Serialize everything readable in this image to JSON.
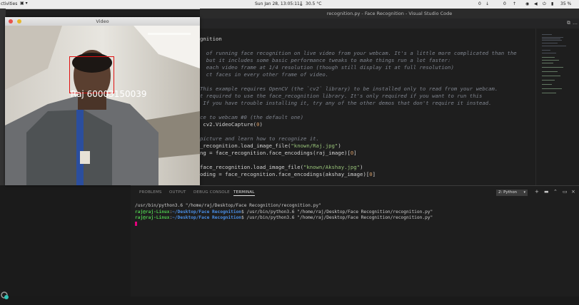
{
  "topbar": {
    "activities": "ctivities",
    "clock": "Sun Jan 28, 13:05:11",
    "temperature": "30.5 °C",
    "net_down": "0",
    "net_up": "0",
    "battery": "35 %"
  },
  "vscode": {
    "window_title": "recognition.py - Face Recognition - Visual Studio Code",
    "code_lines": [
      {
        "kind": "plain",
        "text": "gnition"
      },
      {
        "kind": "blank",
        "text": ""
      },
      {
        "kind": "comment",
        "text": "  of running face recognition on live video from your webcam. It's a little more complicated than the"
      },
      {
        "kind": "comment",
        "text": "  but it includes some basic performance tweaks to make things run a lot faster:"
      },
      {
        "kind": "comment",
        "text": "  each video frame at 1/4 resolution (though still display it at full resolution)"
      },
      {
        "kind": "comment",
        "text": "  ct faces in every other frame of video."
      },
      {
        "kind": "blank",
        "text": ""
      },
      {
        "kind": "comment",
        "text": "This example requires OpenCV (the `cv2` library) to be installed only to read from your webcam."
      },
      {
        "kind": "comment",
        "text": "t required to use the face_recognition library. It's only required if you want to run this"
      },
      {
        "kind": "comment",
        "text": " If you have trouble installing it, try any of the other demos that don't require it instead."
      },
      {
        "kind": "blank",
        "text": ""
      },
      {
        "kind": "comment",
        "text": "ce to webcam #0 (the default one)"
      },
      {
        "kind": "mixed",
        "parts": [
          {
            "c": "plain",
            "t": " cv2.VideoCapture("
          },
          {
            "c": "num",
            "t": "0"
          },
          {
            "c": "plain",
            "t": ")"
          }
        ]
      },
      {
        "kind": "blank",
        "text": ""
      },
      {
        "kind": "comment",
        "text": "picture and learn how to recognize it."
      },
      {
        "kind": "mixed",
        "parts": [
          {
            "c": "plain",
            "t": "_recognition.load_image_file("
          },
          {
            "c": "str",
            "t": "\"known/Raj.jpg\""
          },
          {
            "c": "plain",
            "t": ")"
          }
        ]
      },
      {
        "kind": "mixed",
        "parts": [
          {
            "c": "plain",
            "t": "ng = face_recognition.face_encodings(raj_image)["
          },
          {
            "c": "num",
            "t": "0"
          },
          {
            "c": "plain",
            "t": "]"
          }
        ]
      },
      {
        "kind": "blank",
        "text": ""
      },
      {
        "kind": "mixed",
        "parts": [
          {
            "c": "plain",
            "t": "face_recognition.load_image_file("
          },
          {
            "c": "str",
            "t": "\"known/Akshay.jpg\""
          },
          {
            "c": "plain",
            "t": ")"
          }
        ]
      },
      {
        "kind": "mixed",
        "parts": [
          {
            "c": "plain",
            "t": "oding = face_recognition.face_encodings(akshay_image)["
          },
          {
            "c": "num",
            "t": "0"
          },
          {
            "c": "plain",
            "t": "]"
          }
        ]
      }
    ],
    "panel_tabs": [
      "PROBLEMS",
      "OUTPUT",
      "DEBUG CONSOLE",
      "TERMINAL"
    ],
    "active_panel_tab": "TERMINAL",
    "terminal_select": "2: Python",
    "terminal": {
      "line1": "/usr/bin/python3.6 \"/home/raj/Desktop/Face Recognition/recognition.py\"",
      "prompt_user": "raj@raj-Linux",
      "prompt_sep": ":",
      "prompt_path": "~/Desktop/Face Recognition",
      "cmd2": "$ /usr/bin/python3.6 \"/home/raj/Desktop/Face Recognition/recognition.py\"",
      "cmd3": "$ /usr/bin/python3.6 \"/home/raj/Desktop/Face Recognition/recognition.py\""
    }
  },
  "video_window": {
    "title": "Video",
    "face_label": "Raj 60003150039",
    "box_color": "#e01010"
  },
  "colors": {
    "comment": "#7f848e",
    "string": "#98c379",
    "number": "#d19a66",
    "prompt_user": "#4ec94e",
    "prompt_path": "#4a8fe7"
  }
}
